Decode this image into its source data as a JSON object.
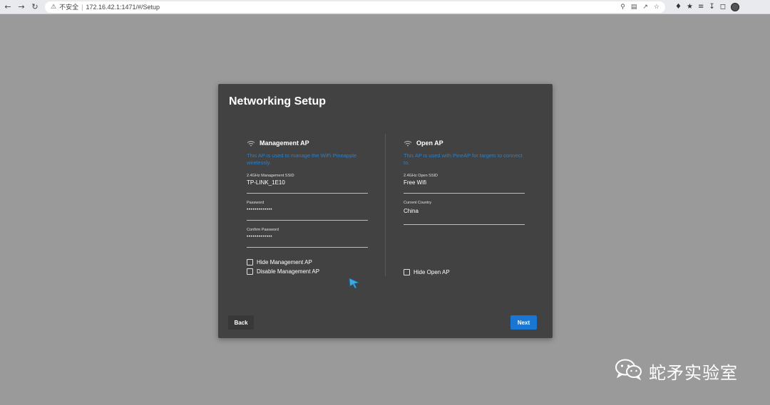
{
  "browser": {
    "security_label": "不安全",
    "url": "172.16.42.1:1471/#/Setup"
  },
  "dialog": {
    "title": "Networking Setup",
    "back_label": "Back",
    "next_label": "Next"
  },
  "management_ap": {
    "title": "Management AP",
    "description": "This AP is used to manage the WiFi Pineapple wirelessly.",
    "ssid_label": "2.4GHz Management SSID",
    "ssid_value": "TP-LINK_1E10",
    "password_label": "Password",
    "password_value": "•••••••••••••",
    "confirm_label": "Confirm Password",
    "confirm_value": "•••••••••••••",
    "hide_label": "Hide Management AP",
    "disable_label": "Disable Management AP",
    "hide_checked": false,
    "disable_checked": false
  },
  "open_ap": {
    "title": "Open AP",
    "description": "This AP is used with PineAP for targets to connect to.",
    "ssid_label": "2.4GHz Open SSID",
    "ssid_value": "Free Wifi",
    "country_label": "Current Country",
    "country_value": "China",
    "hide_label": "Hide Open AP",
    "hide_checked": false
  },
  "colors": {
    "dialog_bg": "#424242",
    "accent": "#1976d2",
    "desc": "#2f7fc4",
    "backdrop": "#9a9a9a"
  },
  "watermark": {
    "text": "蛇矛实验室"
  }
}
